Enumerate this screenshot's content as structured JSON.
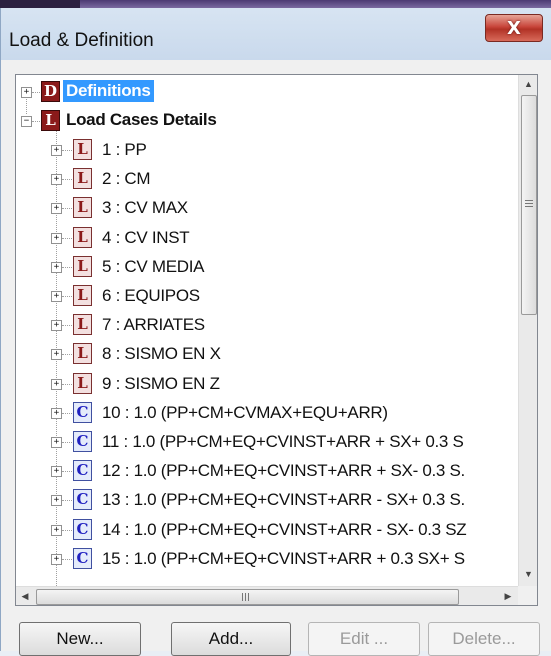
{
  "window": {
    "title": "Load & Definition",
    "close_glyph": "X"
  },
  "tree": {
    "root": {
      "expander": "+",
      "icon": "D",
      "label": "Definitions"
    },
    "group": {
      "expander": "−",
      "icon": "L",
      "label": "Load Cases Details"
    },
    "items": [
      {
        "icon": "L",
        "kind": "load-case",
        "label": "1 : PP"
      },
      {
        "icon": "L",
        "kind": "load-case",
        "label": "2 : CM"
      },
      {
        "icon": "L",
        "kind": "load-case",
        "label": "3 : CV MAX"
      },
      {
        "icon": "L",
        "kind": "load-case",
        "label": "4 : CV INST"
      },
      {
        "icon": "L",
        "kind": "load-case",
        "label": "5 : CV MEDIA"
      },
      {
        "icon": "L",
        "kind": "load-case",
        "label": "6 : EQUIPOS"
      },
      {
        "icon": "L",
        "kind": "load-case",
        "label": "7 : ARRIATES"
      },
      {
        "icon": "L",
        "kind": "load-case",
        "label": "8 : SISMO EN X"
      },
      {
        "icon": "L",
        "kind": "load-case",
        "label": "9 : SISMO EN Z"
      },
      {
        "icon": "C",
        "kind": "combination",
        "label": "10 : 1.0 (PP+CM+CVMAX+EQU+ARR)"
      },
      {
        "icon": "C",
        "kind": "combination",
        "label": "11 : 1.0 (PP+CM+EQ+CVINST+ARR + SX+ 0.3 S"
      },
      {
        "icon": "C",
        "kind": "combination",
        "label": "12 : 1.0 (PP+CM+EQ+CVINST+ARR + SX- 0.3 S."
      },
      {
        "icon": "C",
        "kind": "combination",
        "label": "13 : 1.0 (PP+CM+EQ+CVINST+ARR - SX+ 0.3 S."
      },
      {
        "icon": "C",
        "kind": "combination",
        "label": "14 : 1.0 (PP+CM+EQ+CVINST+ARR - SX- 0.3 SZ"
      },
      {
        "icon": "C",
        "kind": "combination",
        "label": "15 : 1.0 (PP+CM+EQ+CVINST+ARR + 0.3 SX+ S"
      }
    ],
    "item_expander": "+"
  },
  "scrollbar": {
    "up": "▲",
    "down": "▼",
    "left": "◀",
    "right": "▶"
  },
  "buttons": {
    "new": "New...",
    "add": "Add...",
    "edit": "Edit ...",
    "delete": "Delete..."
  },
  "colors": {
    "selection": "#3399ff",
    "definition_icon": "#8b1a1a",
    "combination_icon": "#2020c0"
  }
}
